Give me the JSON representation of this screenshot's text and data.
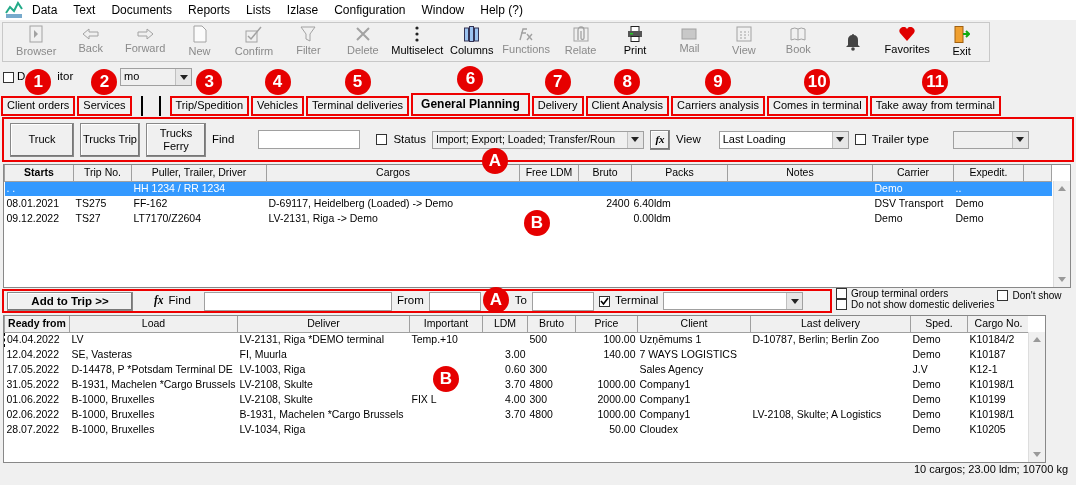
{
  "menu": [
    "Data",
    "Text",
    "Documents",
    "Reports",
    "Lists",
    "Izlase",
    "Configuration",
    "Window",
    "Help (?)"
  ],
  "toolbar": [
    {
      "label": "Browser",
      "kind": "browser",
      "disabled": true
    },
    {
      "label": "Back",
      "kind": "back",
      "disabled": true
    },
    {
      "label": "Forward",
      "kind": "forward",
      "disabled": true
    },
    {
      "label": "New",
      "kind": "page",
      "disabled": true
    },
    {
      "label": "Confirm",
      "kind": "confirm",
      "disabled": true
    },
    {
      "label": "Filter",
      "kind": "filter",
      "disabled": true
    },
    {
      "label": "Delete",
      "kind": "delete",
      "disabled": true
    },
    {
      "label": "Multiselect",
      "kind": "dots",
      "disabled": false
    },
    {
      "label": "Columns",
      "kind": "columns",
      "disabled": false
    },
    {
      "label": "Functions",
      "kind": "fx",
      "disabled": true
    },
    {
      "label": "Relate",
      "kind": "clip",
      "disabled": true
    },
    {
      "label": "Print",
      "kind": "printer",
      "disabled": false
    },
    {
      "label": "Mail",
      "kind": "mail",
      "disabled": true
    },
    {
      "label": "View",
      "kind": "calendar",
      "disabled": true
    },
    {
      "label": "Book",
      "kind": "book",
      "disabled": true
    },
    {
      "kind": "bell",
      "disabled": false
    },
    {
      "label": "Favorites",
      "kind": "heart",
      "disabled": false
    },
    {
      "label": "Exit",
      "kind": "door",
      "disabled": false
    }
  ],
  "dispatcher": {
    "label_start": "D",
    "label_end": "itor",
    "checked": false,
    "value": "mo"
  },
  "tabs": [
    {
      "label": "Client orders",
      "selected": false,
      "callout": "1"
    },
    {
      "label": "Services",
      "selected": false,
      "callout": "2"
    },
    {
      "label": "Trip/Spedition",
      "selected": false,
      "callout": "3"
    },
    {
      "label": "Vehicles",
      "selected": false,
      "callout": "4"
    },
    {
      "label": "Terminal deliveries",
      "selected": false,
      "callout": "5"
    },
    {
      "label": "General Planning",
      "selected": true,
      "callout": "6"
    },
    {
      "label": "Delivery",
      "selected": false,
      "callout": "7"
    },
    {
      "label": "Client Analysis",
      "selected": false,
      "callout": "8"
    },
    {
      "label": "Carriers analysis",
      "selected": false,
      "callout": "9"
    },
    {
      "label": "Comes in terminal",
      "selected": false,
      "callout": "10"
    },
    {
      "label": "Take away from terminal",
      "selected": false,
      "callout": "11"
    }
  ],
  "trip_filter": {
    "callout": "A",
    "buttons": [
      "Truck",
      "Trucks Trip",
      "Trucks Ferry"
    ],
    "find_label": "Find",
    "status_label": "Status",
    "status_checked": false,
    "status_value": "Import; Export; Loaded; Transfer/Roun",
    "fx": "fx",
    "view_label": "View",
    "view_value": "Last Loading",
    "trailer_label": "Trailer type",
    "trailer_checked": false
  },
  "trips_table": {
    "callout": "B",
    "columns": [
      "Starts",
      "Trip No.",
      "Puller, Trailer, Driver",
      "Cargos",
      "Free LDM",
      "Bruto",
      "Packs",
      "Notes",
      "Carrier",
      "Expedit."
    ],
    "rows": [
      {
        "selected": true,
        "cells": [
          ". .",
          "",
          "HH 1234 / RR 1234",
          "",
          "",
          "",
          "",
          "",
          "Demo",
          ".."
        ]
      },
      {
        "selected": false,
        "cells": [
          "08.01.2021",
          "TS275",
          "FF-162",
          "D-69117, Heidelberg (Loaded) -> Demo",
          "",
          "2400",
          "6.40ldm",
          "",
          "DSV Transport",
          "Demo"
        ]
      },
      {
        "selected": false,
        "cells": [
          "09.12.2022",
          "TS27",
          "LT7170/Z2604",
          "LV-2131, Riga -> Demo",
          "",
          "",
          "0.00ldm",
          "",
          "Demo",
          "Demo"
        ]
      }
    ]
  },
  "cargo_filter": {
    "callout": "A",
    "add_button": "Add to Trip >>",
    "fx": "fx",
    "find_label": "Find",
    "from_label": "From",
    "to_label": "To",
    "terminal_label": "Terminal",
    "terminal_checked": true,
    "group_label": "Group terminal orders",
    "group_checked": false,
    "domestic_label": "Do not show domestic deliveries",
    "domestic_checked": false,
    "dont_show_label": "Don't show",
    "dont_show_checked": false
  },
  "cargo_table": {
    "callout": "B",
    "columns": [
      "Ready from",
      "Load",
      "Deliver",
      "Important",
      "LDM",
      "Bruto",
      "Price",
      "Client",
      "Last delivery",
      "Sped.",
      "Cargo No."
    ],
    "rows": [
      {
        "focused": true,
        "cells": [
          "04.04.2022",
          "LV",
          "LV-2131, Riga *DEMO terminal",
          "Temp.+10",
          "",
          "500",
          "100.00",
          "Uzņēmums 1",
          "D-10787, Berlin; Berlin Zoo",
          "Demo",
          "K10184/2"
        ]
      },
      {
        "focused": false,
        "cells": [
          "12.04.2022",
          "SE, Vasteras",
          "FI, Muurla",
          "",
          "3.00",
          "",
          "140.00",
          "7 WAYS LOGISTICS",
          "",
          "Demo",
          "K10187"
        ]
      },
      {
        "focused": false,
        "cells": [
          "17.05.2022",
          "D-14478, P *Potsdam Terminal DE",
          "LV-1003, Riga",
          "",
          "0.60",
          "300",
          "",
          "Sales Agency",
          "",
          "J.V",
          "K12-1"
        ]
      },
      {
        "focused": false,
        "cells": [
          "31.05.2022",
          "B-1931, Machelen *Cargo Brussels",
          "LV-2108, Skulte",
          "",
          "3.70",
          "4800",
          "1000.00",
          "Company1",
          "",
          "Demo",
          "K10198/1"
        ]
      },
      {
        "focused": false,
        "cells": [
          "01.06.2022",
          "B-1000, Bruxelles",
          "LV-2108, Skulte",
          "FIX L",
          "4.00",
          "300",
          "2000.00",
          "Company1",
          "",
          "Demo",
          "K10199"
        ]
      },
      {
        "focused": false,
        "cells": [
          "02.06.2022",
          "B-1000, Bruxelles",
          "B-1931, Machelen *Cargo Brussels",
          "",
          "3.70",
          "4800",
          "1000.00",
          "Company1",
          "LV-2108, Skulte; A Logistics",
          "Demo",
          "K10198/1"
        ]
      },
      {
        "focused": false,
        "cells": [
          "28.07.2022",
          "B-1000, Bruxelles",
          "LV-1034, Riga",
          "",
          "",
          "",
          "50.00",
          "Cloudex",
          "",
          "Demo",
          "K10205"
        ]
      }
    ]
  },
  "status_bar": "10 cargos; 23.00 ldm; 10700 kg"
}
